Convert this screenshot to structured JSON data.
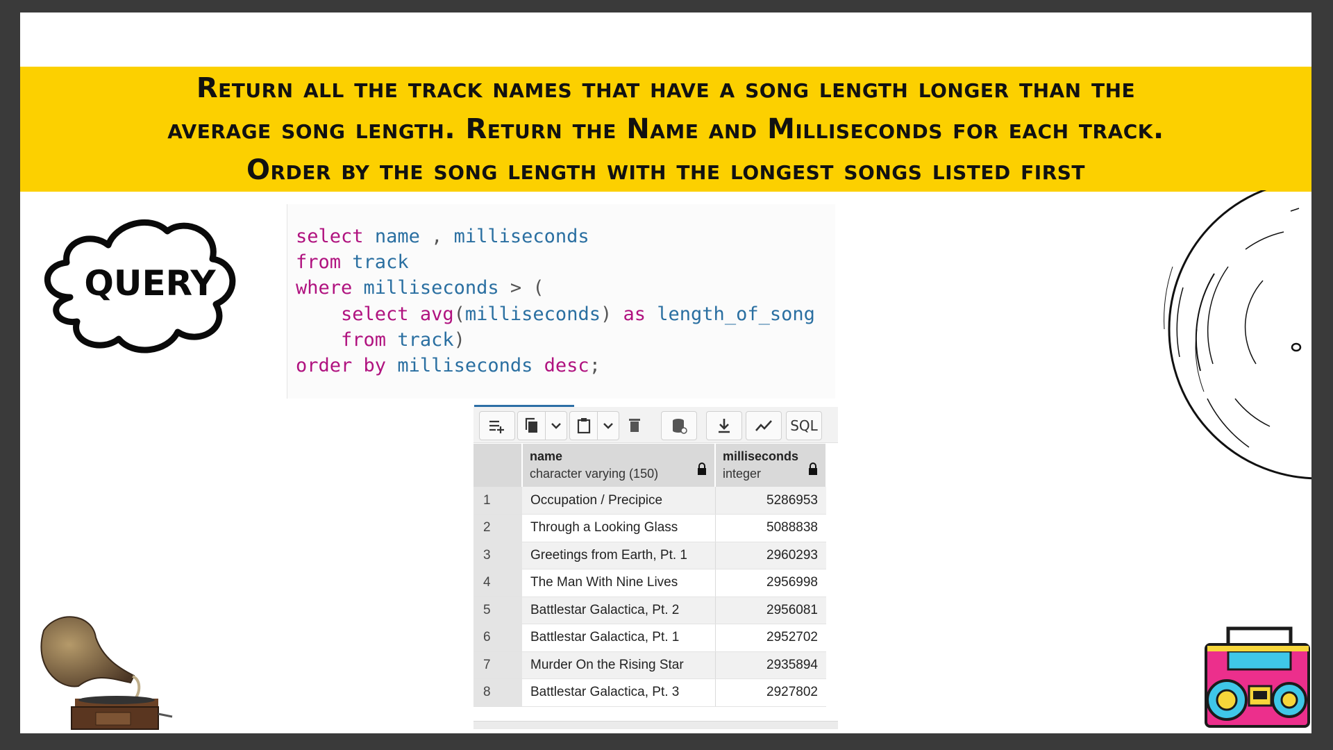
{
  "banner": {
    "text": "Return all the track names that have a song length longer than the average song length. Return the Name and Milliseconds for each track. Order by the song length with the longest songs listed first"
  },
  "cloud_label": "QUERY",
  "sql": {
    "line1_kw": "select",
    "line1_id1": "name",
    "line1_pn": " ,",
    "line1_id2": "milliseconds",
    "line2_kw": "from",
    "line2_id": "track",
    "line3_kw": "where",
    "line3_id": "milliseconds",
    "line3_pn": " > (",
    "line4_kw1": "select",
    "line4_kw2": "avg",
    "line4_pn1": "(",
    "line4_id1": "milliseconds",
    "line4_pn2": ")",
    "line4_kw3": "as",
    "line4_id2": "length_of_song",
    "line5_kw": "from",
    "line5_id": "track",
    "line5_pn": ")",
    "line6_kw1": "order by",
    "line6_id": "milliseconds",
    "line6_kw2": "desc",
    "line6_pn": ";"
  },
  "toolbar": {
    "sql_label": "SQL"
  },
  "grid": {
    "columns": [
      {
        "name": "name",
        "type": "character varying (150)"
      },
      {
        "name": "milliseconds",
        "type": "integer"
      }
    ],
    "rows": [
      {
        "n": "1",
        "name": "Occupation / Precipice",
        "ms": "5286953"
      },
      {
        "n": "2",
        "name": "Through a Looking Glass",
        "ms": "5088838"
      },
      {
        "n": "3",
        "name": "Greetings from Earth, Pt. 1",
        "ms": "2960293"
      },
      {
        "n": "4",
        "name": "The Man With Nine Lives",
        "ms": "2956998"
      },
      {
        "n": "5",
        "name": "Battlestar Galactica, Pt. 2",
        "ms": "2956081"
      },
      {
        "n": "6",
        "name": "Battlestar Galactica, Pt. 1",
        "ms": "2952702"
      },
      {
        "n": "7",
        "name": "Murder On the Rising Star",
        "ms": "2935894"
      },
      {
        "n": "8",
        "name": "Battlestar Galactica, Pt. 3",
        "ms": "2927802"
      }
    ]
  },
  "colors": {
    "banner": "#fcd000",
    "keyword": "#b0127f",
    "identifier": "#2a6fa1",
    "grid_header": "#d9d9d9"
  },
  "icons": [
    "add-row-icon",
    "copy-icon",
    "chevron-down-icon",
    "paste-icon",
    "delete-icon",
    "save-data-icon",
    "download-icon",
    "graph-icon",
    "lock-icon",
    "vinyl-record-icon",
    "gramophone-icon",
    "boombox-icon"
  ]
}
